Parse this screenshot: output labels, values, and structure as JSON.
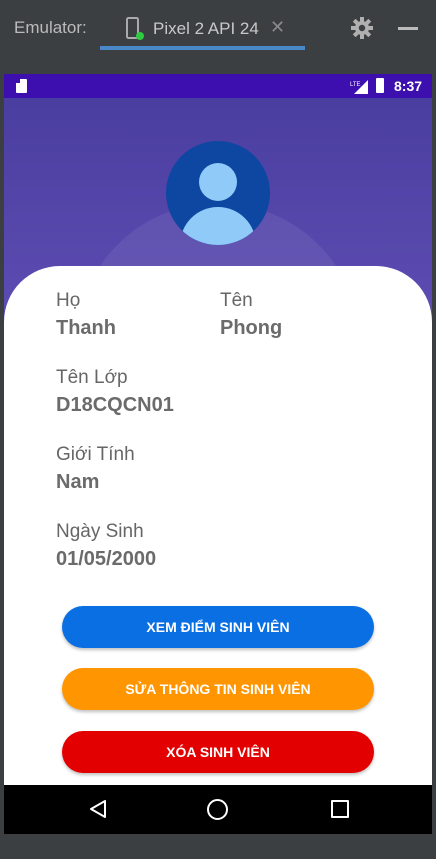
{
  "emulator": {
    "title": "Emulator:",
    "tab_label": "Pixel 2 API 24",
    "tab_close": "✕"
  },
  "status_bar": {
    "network": "LTE",
    "time": "8:37",
    "color": "#3d0fae"
  },
  "header": {
    "avatar_icon": "account-circle-icon"
  },
  "student": {
    "last_name_label": "Họ",
    "last_name": "Thanh",
    "first_name_label": "Tên",
    "first_name": "Phong",
    "class_label": "Tên Lớp",
    "class_name": "D18CQCN01",
    "gender_label": "Giới Tính",
    "gender": "Nam",
    "dob_label": "Ngày Sinh",
    "dob": "01/05/2000"
  },
  "actions": {
    "view_grades": {
      "label": "XEM ĐIỂM SINH VIÊN",
      "color": "#0a6fe3"
    },
    "edit_info": {
      "label": "SỬA THÔNG TIN SINH VIÊN",
      "color": "#ff9500"
    },
    "delete": {
      "label": "XÓA SINH VIÊN",
      "color": "#e30000"
    }
  },
  "nav": {
    "back_icon": "back-triangle-icon",
    "home_icon": "home-circle-icon",
    "recent_icon": "recent-square-icon"
  }
}
